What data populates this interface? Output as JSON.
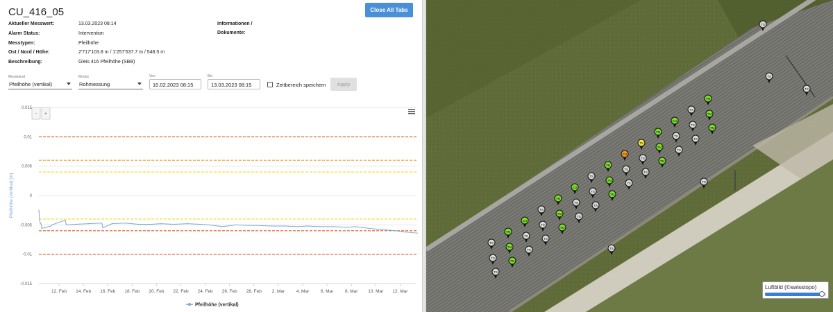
{
  "header": {
    "title": "CU_416_05",
    "close_all_tabs": "Close All Tabs"
  },
  "info": {
    "rows": [
      {
        "label": "Aktueller Messwert:",
        "value": "13.03.2023 08:14"
      },
      {
        "label": "Alarm Status:",
        "value": "Intervention"
      },
      {
        "label": "Messtypen:",
        "value": "Pfeilhöhe"
      },
      {
        "label": "Ost / Nord / Höhe:",
        "value": "2'717'103.8 m / 1'257'537.7 m / 548.5 m"
      },
      {
        "label": "Beschreibung:",
        "value": "Gleis 416 Pfeilhöhe (SBB)"
      }
    ],
    "documents_label_line1": "Informationen /",
    "documents_label_line2": "Dokumente:"
  },
  "controls": {
    "messkanal_label": "Messkanal",
    "messkanal_value": "Pfeilhöhe (vertikal)",
    "modus_label": "Modus",
    "modus_value": "Rohmessung",
    "von_label": "Von",
    "von_value": "10.02.2023 08:15",
    "bis_label": "Bis",
    "bis_value": "13.03.2023 08:15",
    "save_range_label": "Zeitbereich speichern",
    "save_range_checked": false,
    "apply_label": "Apply"
  },
  "chart_data": {
    "type": "line",
    "title": "",
    "xlabel": "",
    "ylabel": "Pfeilhöhe (vertikal) [m]",
    "ylim": [
      -0.015,
      0.015
    ],
    "yticks": [
      0.015,
      0.01,
      0.005,
      0,
      -0.005,
      -0.01,
      -0.015
    ],
    "ytick_labels": [
      "0.015",
      "0.01",
      "0.005",
      "0",
      "-0.005",
      "-0.01",
      "-0.015"
    ],
    "xlim": [
      "2023-02-10",
      "2023-03-13"
    ],
    "xtick_labels": [
      "12. Feb",
      "14. Feb",
      "16. Feb",
      "18. Feb",
      "20. Feb",
      "22. Feb",
      "24. Feb",
      "26. Feb",
      "28. Feb",
      "2. Mar",
      "4. Mar",
      "6. Mar",
      "8. Mar",
      "10. Mar",
      "12. Mar"
    ],
    "xtick_dates": [
      "2023-02-12",
      "2023-02-14",
      "2023-02-16",
      "2023-02-18",
      "2023-02-20",
      "2023-02-22",
      "2023-02-24",
      "2023-02-26",
      "2023-02-28",
      "2023-03-02",
      "2023-03-04",
      "2023-03-06",
      "2023-03-08",
      "2023-03-10",
      "2023-03-12"
    ],
    "thresholds": [
      {
        "value": 0.01,
        "color": "#e8551c"
      },
      {
        "value": 0.006,
        "color": "#f4a020"
      },
      {
        "value": 0.004,
        "color": "#f2e030"
      },
      {
        "value": -0.004,
        "color": "#f2e030"
      },
      {
        "value": -0.006,
        "color": "#e8551c"
      },
      {
        "value": -0.01,
        "color": "#e8551c"
      }
    ],
    "series": [
      {
        "name": "Pfeilhöhe (vertikal)",
        "color": "#7ea6d8",
        "x": [
          "2023-02-10",
          "2023-02-10",
          "2023-02-10",
          "2023-02-10",
          "2023-02-11",
          "2023-02-11",
          "2023-02-12",
          "2023-02-12",
          "2023-02-13",
          "2023-02-14",
          "2023-02-15",
          "2023-02-15",
          "2023-02-16",
          "2023-02-17",
          "2023-02-18",
          "2023-02-19",
          "2023-02-20",
          "2023-02-21",
          "2023-02-22",
          "2023-02-23",
          "2023-02-24",
          "2023-02-25",
          "2023-02-26",
          "2023-02-27",
          "2023-02-28",
          "2023-03-01",
          "2023-03-02",
          "2023-03-03",
          "2023-03-04",
          "2023-03-05",
          "2023-03-06",
          "2023-03-07",
          "2023-03-08",
          "2023-03-09",
          "2023-03-10",
          "2023-03-11",
          "2023-03-12",
          "2023-03-13"
        ],
        "y": [
          -0.0025,
          -0.0045,
          -0.0048,
          -0.0056,
          -0.0052,
          -0.005,
          -0.0042,
          -0.005,
          -0.0049,
          -0.0048,
          -0.0047,
          -0.0055,
          -0.0048,
          -0.0047,
          -0.0049,
          -0.0049,
          -0.0048,
          -0.0049,
          -0.0048,
          -0.0049,
          -0.005,
          -0.0053,
          -0.005,
          -0.0051,
          -0.0051,
          -0.0052,
          -0.0052,
          -0.0053,
          -0.0052,
          -0.0053,
          -0.0053,
          -0.0054,
          -0.0053,
          -0.0056,
          -0.0058,
          -0.006,
          -0.0062,
          -0.0064
        ]
      }
    ],
    "legend": "bottom-center",
    "grid": true
  },
  "chart_buttons": {
    "minus": "-",
    "plus": "+"
  },
  "map": {
    "layer_label": "Luftbild (©swisstopo)",
    "opacity": 0.93,
    "markers": [
      {
        "label": "TS",
        "status": "normal",
        "count": 30
      },
      {
        "label": "TM",
        "status": "ok",
        "count": 24
      },
      {
        "label": "CU",
        "status": "ok",
        "count": 12
      },
      {
        "label": "CU",
        "status": "warn",
        "count": 1
      },
      {
        "label": "CU",
        "status": "alarm",
        "count": 1
      }
    ],
    "colors": {
      "normal": "#d9d9d9",
      "ok": "#7ddc2c",
      "warn": "#f2e640",
      "alarm": "#f39a2a"
    }
  }
}
